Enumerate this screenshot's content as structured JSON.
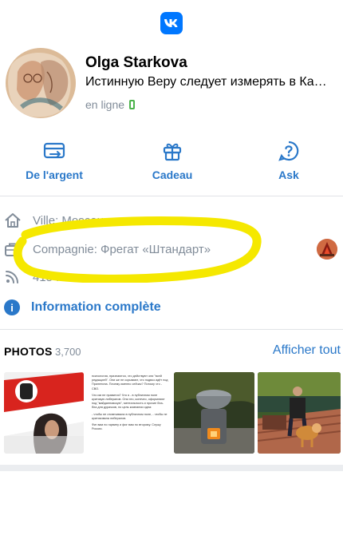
{
  "app": {
    "logo": "VK",
    "logo_color": "#0077ff"
  },
  "profile": {
    "name": "Olga Starkova",
    "status": "Истинную Веру следует измерять в Ка…",
    "online": "en ligne"
  },
  "actions": [
    {
      "label": "De l'argent",
      "icon": "money-transfer-icon"
    },
    {
      "label": "Cadeau",
      "icon": "gift-icon"
    },
    {
      "label": "Ask",
      "icon": "question-icon"
    }
  ],
  "info": {
    "city": "Ville: Moscou",
    "company": "Compagnie: Фрегат «Штандарт»",
    "fans": "415 fans",
    "more": "Information complète"
  },
  "photos": {
    "title": "PHOTOS",
    "count": "3,700",
    "show_all": "Afficher tout",
    "doc_lines": [
      "психология, признаются, что действуют они \"всей редакцией\". Они же не скрывают, что подвоз идёт под Прилепина. Почему именно сейчас? Потому что - СВО.",
      "Что им не нравится? Что я - в публичном поле критикую либералов. Они это, конечно, оформляют под \"майданновскую\", ментальность и прочие бла-бла для дурачков, но цель компании одна:",
      "- чтобы не отсвечивала в публичном поле, - чтобы не критиковала либералов.",
      "Фиг вам по гарвину и фиг вам по второму. Служу России."
    ]
  },
  "colors": {
    "accent": "#2a78c9",
    "muted": "#818c99",
    "highlight": "#f5e800",
    "online": "#4bb34b"
  }
}
